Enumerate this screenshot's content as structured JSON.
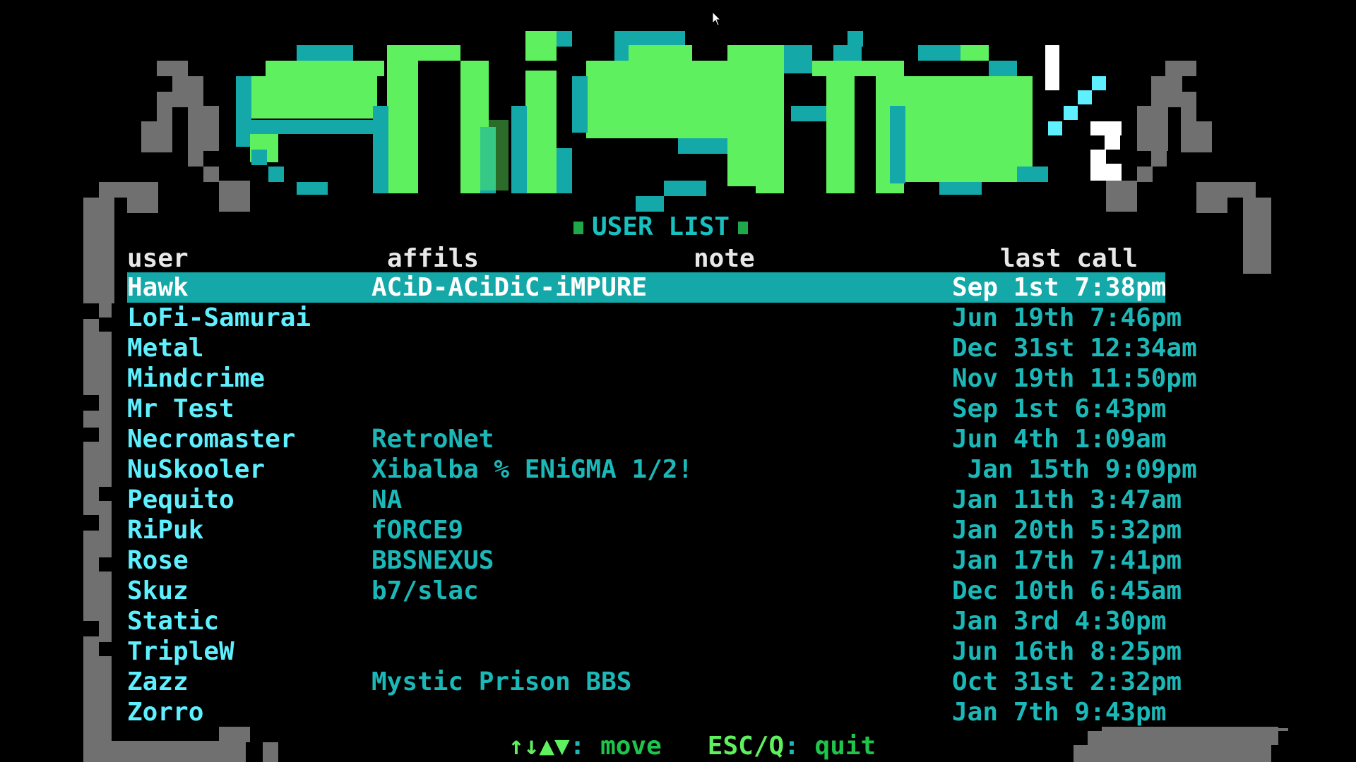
{
  "logo": {
    "text": "eniGma½"
  },
  "title": "USER LIST",
  "headers": {
    "user": "user",
    "affils": "affils",
    "note": "note",
    "last_call": "last call"
  },
  "users": [
    {
      "user": "Hawk",
      "affils": "ACiD-ACiDiC-iMPURE",
      "note": "",
      "last_call": "Sep 1st 7:38pm",
      "selected": true
    },
    {
      "user": "LoFi-Samurai",
      "affils": "",
      "note": "",
      "last_call": "Jun 19th 7:46pm"
    },
    {
      "user": "Metal",
      "affils": "",
      "note": "",
      "last_call": "Dec 31st 12:34am"
    },
    {
      "user": "Mindcrime",
      "affils": "",
      "note": "",
      "last_call": "Nov 19th 11:50pm"
    },
    {
      "user": "Mr Test",
      "affils": "",
      "note": "",
      "last_call": "Sep 1st 6:43pm"
    },
    {
      "user": "Necromaster",
      "affils": "RetroNet",
      "note": "",
      "last_call": "Jun 4th 1:09am"
    },
    {
      "user": "NuSkooler",
      "affils": "Xibalba % ENiGMA 1/2!",
      "note": "",
      "last_call": " Jan 15th 9:09pm"
    },
    {
      "user": "Pequito",
      "affils": "NA",
      "note": "",
      "last_call": "Jan 11th 3:47am"
    },
    {
      "user": "RiPuk",
      "affils": "fORCE9",
      "note": "",
      "last_call": "Jan 20th 5:32pm"
    },
    {
      "user": "Rose",
      "affils": "BBSNEXUS",
      "note": "",
      "last_call": "Jan 17th 7:41pm"
    },
    {
      "user": "Skuz",
      "affils": "b7/slac",
      "note": "",
      "last_call": "Dec 10th 6:45am"
    },
    {
      "user": "Static",
      "affils": "",
      "note": "",
      "last_call": "Jan 3rd 4:30pm"
    },
    {
      "user": "TripleW",
      "affils": "",
      "note": "",
      "last_call": "Jun 16th 8:25pm"
    },
    {
      "user": "Zazz",
      "affils": "Mystic Prison BBS",
      "note": "",
      "last_call": "Oct 31st 2:32pm"
    },
    {
      "user": "Zorro",
      "affils": "",
      "note": "",
      "last_call": "Jan 7th 9:43pm"
    }
  ],
  "footer": {
    "move_keys": "↑↓▲▼",
    "move_sep": ":",
    "move_label": " move",
    "quit_keys": "ESC/Q",
    "quit_sep": ":",
    "quit_label": " quit"
  },
  "colors": {
    "background": "#000000",
    "logo_green": "#5ff05f",
    "logo_teal": "#14a8a8",
    "frame_gray": "#707070",
    "selection": "#14a8a8",
    "text_cyan": "#5ff0ff"
  }
}
